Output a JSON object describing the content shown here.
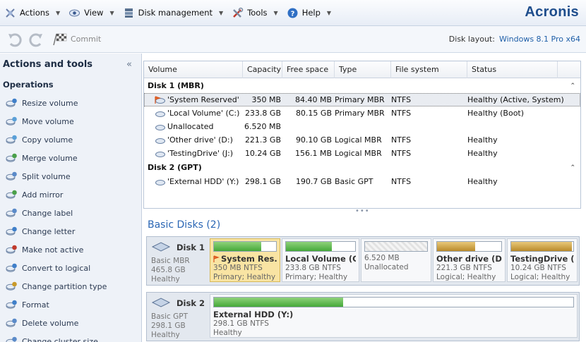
{
  "menubar": {
    "items": [
      {
        "label": "Actions",
        "icon": "actions-icon"
      },
      {
        "label": "View",
        "icon": "eye-icon"
      },
      {
        "label": "Disk management",
        "icon": "disk-management-icon"
      },
      {
        "label": "Tools",
        "icon": "tools-icon"
      },
      {
        "label": "Help",
        "icon": "help-icon"
      }
    ],
    "brand": "Acronis"
  },
  "toolbar": {
    "commit_label": "Commit",
    "disk_layout_label": "Disk layout:",
    "disk_layout_value": "Windows 8.1 Pro x64"
  },
  "sidebar": {
    "title": "Actions and tools",
    "section": "Operations",
    "items": [
      {
        "label": "Resize volume",
        "icon": "resize-volume-icon"
      },
      {
        "label": "Move volume",
        "icon": "move-volume-icon"
      },
      {
        "label": "Copy volume",
        "icon": "copy-volume-icon"
      },
      {
        "label": "Merge volume",
        "icon": "merge-volume-icon"
      },
      {
        "label": "Split volume",
        "icon": "split-volume-icon"
      },
      {
        "label": "Add mirror",
        "icon": "add-mirror-icon"
      },
      {
        "label": "Change label",
        "icon": "change-label-icon"
      },
      {
        "label": "Change letter",
        "icon": "change-letter-icon"
      },
      {
        "label": "Make not active",
        "icon": "make-not-active-icon"
      },
      {
        "label": "Convert to logical",
        "icon": "convert-to-logical-icon"
      },
      {
        "label": "Change partition type",
        "icon": "change-partition-type-icon"
      },
      {
        "label": "Format",
        "icon": "format-icon"
      },
      {
        "label": "Delete volume",
        "icon": "delete-volume-icon"
      },
      {
        "label": "Change cluster size",
        "icon": "change-cluster-size-icon"
      }
    ]
  },
  "volume_table": {
    "columns": [
      "Volume",
      "Capacity",
      "Free space",
      "Type",
      "File system",
      "Status"
    ],
    "groups": [
      {
        "name": "Disk 1 (MBR)",
        "rows": [
          {
            "volume": "'System Reserved'",
            "capacity": "350 MB",
            "free": "84.40 MB",
            "type": "Primary MBR",
            "fs": "NTFS",
            "status": "Healthy (Active, System)",
            "selected": true,
            "flag": true
          },
          {
            "volume": "'Local Volume' (C:)",
            "capacity": "233.8 GB",
            "free": "80.15 GB",
            "type": "Primary MBR",
            "fs": "NTFS",
            "status": "Healthy (Boot)"
          },
          {
            "volume": "Unallocated",
            "capacity": "6.520 MB",
            "free": "",
            "type": "",
            "fs": "",
            "status": ""
          },
          {
            "volume": "'Other drive' (D:)",
            "capacity": "221.3 GB",
            "free": "90.10 GB",
            "type": "Logical MBR",
            "fs": "NTFS",
            "status": "Healthy"
          },
          {
            "volume": "'TestingDrive' (J:)",
            "capacity": "10.24 GB",
            "free": "156.1 MB",
            "type": "Logical MBR",
            "fs": "NTFS",
            "status": "Healthy"
          }
        ]
      },
      {
        "name": "Disk 2 (GPT)",
        "rows": [
          {
            "volume": "'External HDD' (Y:)",
            "capacity": "298.1 GB",
            "free": "190.7 GB",
            "type": "Basic GPT",
            "fs": "NTFS",
            "status": "Healthy"
          }
        ]
      }
    ]
  },
  "basic_disks": {
    "title": "Basic Disks (2)",
    "disks": [
      {
        "name": "Disk 1",
        "line1": "Basic MBR",
        "line2": "465.8 GB",
        "line3": "Healthy",
        "partitions": [
          {
            "name": "System Res...",
            "line1": "350 MB NTFS",
            "line2": "Primary; Healthy",
            "used": 0.76,
            "color": "green",
            "selected": true,
            "flag": true
          },
          {
            "name": "Local Volume (C:)",
            "line1": "233.8 GB NTFS",
            "line2": "Primary; Healthy",
            "used": 0.66,
            "color": "green"
          },
          {
            "name": "",
            "line1": "6.520 MB",
            "line2": "Unallocated",
            "used": 0,
            "color": "unalloc"
          },
          {
            "name": "Other drive (D:)",
            "line1": "221.3 GB NTFS",
            "line2": "Logical; Healthy",
            "used": 0.59,
            "color": "gold"
          },
          {
            "name": "TestingDrive (...",
            "line1": "10.24 GB NTFS",
            "line2": "Logical; Healthy",
            "used": 0.98,
            "color": "gold"
          }
        ]
      },
      {
        "name": "Disk 2",
        "line1": "Basic GPT",
        "line2": "298.1 GB",
        "line3": "Healthy",
        "partitions": [
          {
            "name": "External HDD (Y:)",
            "line1": "298.1 GB NTFS",
            "line2": "Healthy",
            "used": 0.36,
            "color": "green"
          }
        ]
      }
    ]
  }
}
